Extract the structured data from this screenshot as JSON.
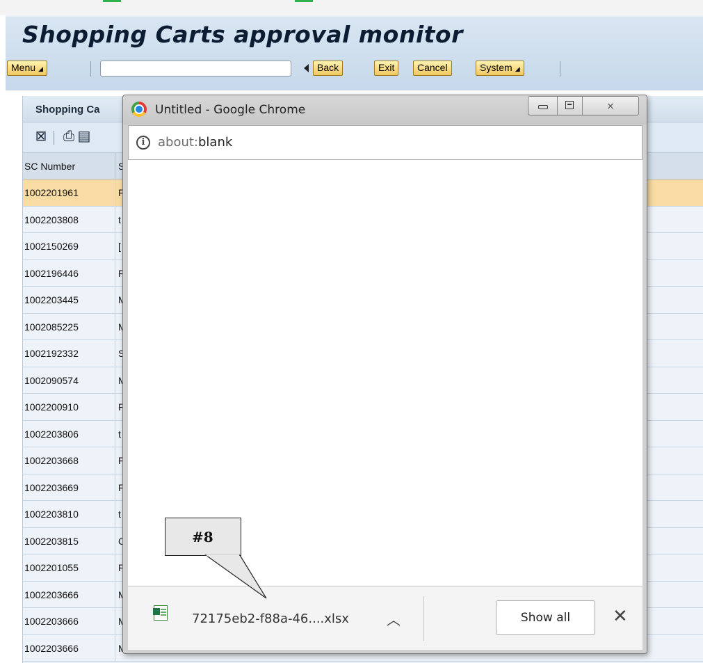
{
  "sap": {
    "title": "Shopping Carts approval monitor",
    "toolbar": {
      "menu": "Menu",
      "command_value": "",
      "back": "Back",
      "exit": "Exit",
      "cancel": "Cancel",
      "system": "System"
    }
  },
  "panel": {
    "title": "Shopping Ca",
    "icons": [
      "find-icon",
      "print-icon",
      "filter-icon"
    ],
    "columns": [
      "SC Number",
      "S"
    ],
    "rows": [
      {
        "sc": "1002201961",
        "s": "F",
        "selected": true
      },
      {
        "sc": "1002203808",
        "s": "t"
      },
      {
        "sc": "1002150269",
        "s": "["
      },
      {
        "sc": "1002196446",
        "s": "F"
      },
      {
        "sc": "1002203445",
        "s": "M"
      },
      {
        "sc": "1002085225",
        "s": "M"
      },
      {
        "sc": "1002192332",
        "s": "S"
      },
      {
        "sc": "1002090574",
        "s": "M"
      },
      {
        "sc": "1002200910",
        "s": "F"
      },
      {
        "sc": "1002203806",
        "s": "t"
      },
      {
        "sc": "1002203668",
        "s": "F"
      },
      {
        "sc": "1002203669",
        "s": "F"
      },
      {
        "sc": "1002203810",
        "s": "t"
      },
      {
        "sc": "1002203815",
        "s": "C"
      },
      {
        "sc": "1002201055",
        "s": "F"
      },
      {
        "sc": "1002203666",
        "s": "M"
      },
      {
        "sc": "1002203666",
        "s": "M"
      },
      {
        "sc": "1002203666",
        "s": "M"
      }
    ]
  },
  "chrome": {
    "window_title": "Untitled - Google Chrome",
    "url_scheme": "about:",
    "url_rest": "blank",
    "download": {
      "file_name": "72175eb2-f88a-46....xlsx",
      "show_all": "Show all"
    }
  },
  "annotation": {
    "label": "#8"
  },
  "colors": {
    "sap_button": "#f0c860",
    "selected_row": "#f8dca3",
    "panel_bg": "#e9f0f7"
  }
}
